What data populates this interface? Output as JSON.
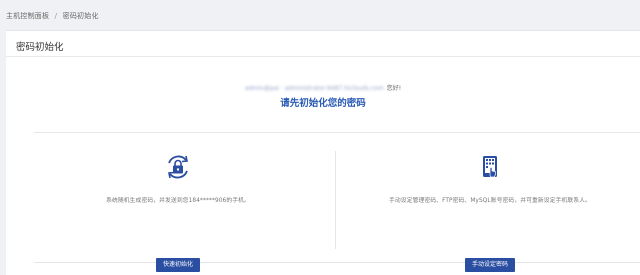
{
  "breadcrumb": {
    "home": "主机控制面板",
    "separator": "/",
    "current": "密码初始化"
  },
  "panel": {
    "title": "密码初始化"
  },
  "account": {
    "email": "admin@pai · administrator-9487.hiclouds.com",
    "greeting": "您好!"
  },
  "heading": "请先初始化您的密码",
  "options": {
    "auto": {
      "icon": "lock-refresh-icon",
      "description": "系统随机生成密码，并发送到您184*****906的手机。",
      "button": "快速初始化"
    },
    "manual": {
      "icon": "keypad-hand-icon",
      "description": "手动设定管理密码、FTP密码、MySQL账号密码，并可重新设定手机联系人。",
      "button": "手动设定密码"
    }
  },
  "colors": {
    "accent": "#2b5bb5",
    "button": "#2a4ea1",
    "background": "#f0f1f4"
  }
}
